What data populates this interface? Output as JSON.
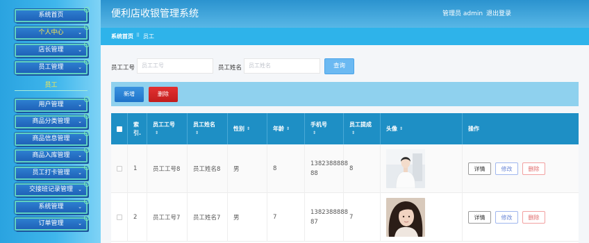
{
  "sidebar": {
    "items": [
      {
        "label": "系统首页",
        "active": false,
        "chevron": false
      },
      {
        "label": "个人中心",
        "active": true,
        "chevron": true
      },
      {
        "label": "店长管理",
        "active": false,
        "chevron": true
      },
      {
        "label": "员工管理",
        "active": false,
        "chevron": true
      },
      {
        "label": "用户管理",
        "active": false,
        "chevron": true
      },
      {
        "label": "商品分类管理",
        "active": false,
        "chevron": true
      },
      {
        "label": "商品信息管理",
        "active": false,
        "chevron": true
      },
      {
        "label": "商品入库管理",
        "active": false,
        "chevron": true
      },
      {
        "label": "员工打卡管理",
        "active": false,
        "chevron": true
      },
      {
        "label": "交接班记录管理",
        "active": false,
        "chevron": true
      },
      {
        "label": "系统管理",
        "active": false,
        "chevron": true
      },
      {
        "label": "订单管理",
        "active": false,
        "chevron": true
      }
    ],
    "sub_item": "员工",
    "chevron_glyph": "⌄"
  },
  "header": {
    "title": "便利店收银管理系统",
    "user": "管理员 admin",
    "logout": "退出登录"
  },
  "breadcrumb": {
    "home": "系统首页",
    "separator": "⠿",
    "current": "员工"
  },
  "search": {
    "id_label": "员工工号",
    "id_placeholder": "员工工号",
    "name_label": "员工姓名",
    "name_placeholder": "员工姓名",
    "button": "查询"
  },
  "actions": {
    "add": "新增",
    "delete": "删除"
  },
  "table": {
    "headers": {
      "index": [
        "索",
        "引."
      ],
      "emp_id": "员工工号",
      "emp_name": "员工姓名",
      "gender": "性别",
      "age": "年龄",
      "phone": "手机号",
      "commission": "员工提成",
      "avatar": "头像",
      "ops": "操作"
    },
    "sort_glyph": "⇕",
    "rows": [
      {
        "index": "1",
        "emp_id": "员工工号8",
        "emp_name": "员工姓名8",
        "gender": "男",
        "age": "8",
        "phone": [
          "1382388888",
          "88"
        ],
        "commission": "8",
        "avatar": "person-white-shirt"
      },
      {
        "index": "2",
        "emp_id": "员工工号7",
        "emp_name": "员工姓名7",
        "gender": "男",
        "age": "7",
        "phone": [
          "1382388888",
          "87"
        ],
        "commission": "7",
        "avatar": "person-long-hair"
      }
    ],
    "row_buttons": {
      "detail": "详情",
      "edit": "修改",
      "delete": "删除"
    }
  },
  "colors": {
    "sidebar": "#2aa3e0",
    "header": "#2b93cf",
    "breadcrumb": "#2eb3ea",
    "table_head": "#1e8fc5",
    "action_bar": "#8fd1ee",
    "danger": "#d42323",
    "primary": "#2b86d8",
    "active_menu_text": "#ffe94a"
  }
}
